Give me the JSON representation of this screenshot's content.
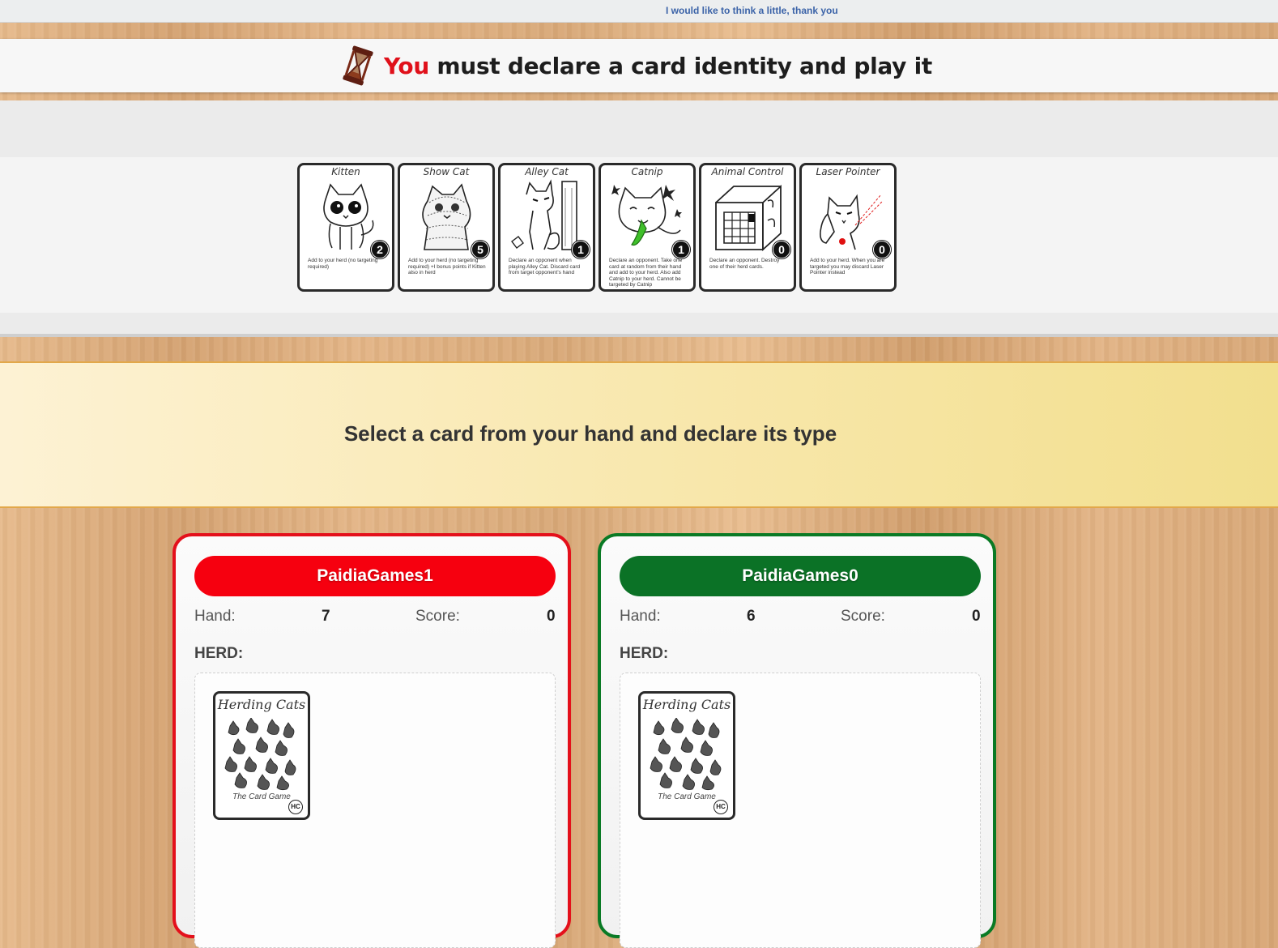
{
  "header": {
    "link_text": "I would like to think a little, thank you",
    "status_you": "You",
    "status_rest": " must declare a card identity and play it"
  },
  "reference_cards": [
    {
      "title": "Kitten",
      "value": "2",
      "text": "Add to your herd (no targeting required)",
      "icon": "kitten-icon"
    },
    {
      "title": "Show Cat",
      "value": "5",
      "text": "Add to your herd (no targeting required) +I bonus points if Kitten also in herd",
      "icon": "show-cat-icon"
    },
    {
      "title": "Alley Cat",
      "value": "1",
      "text": "Declare an opponent when playing Alley Cat. Discard card from target opponent's hand",
      "icon": "alley-cat-icon"
    },
    {
      "title": "Catnip",
      "value": "1",
      "text": "Declare an opponent. Take one card at random from their hand and add to your herd. Also add Catnip to your herd. Cannot be targeted by Catnip",
      "icon": "catnip-icon"
    },
    {
      "title": "Animal Control",
      "value": "0",
      "text": "Declare an opponent. Destroy one of their herd cards.",
      "icon": "animal-control-icon"
    },
    {
      "title": "Laser Pointer",
      "value": "0",
      "text": "Add to your herd. When you are targeted you may discard Laser Pointer instead",
      "icon": "laser-pointer-icon"
    }
  ],
  "prompt": {
    "text": "Select a card from your hand and declare its type"
  },
  "labels": {
    "hand": "Hand:",
    "score": "Score:",
    "herd": "HERD:"
  },
  "players": [
    {
      "name": "PaidiaGames1",
      "hand": "7",
      "score": "0",
      "color": "#f6000f",
      "herd_card": {
        "title": "Herding Cats",
        "subtitle": "The Card Game",
        "badge": "HC"
      }
    },
    {
      "name": "PaidiaGames0",
      "hand": "6",
      "score": "0",
      "color": "#0b7226",
      "herd_card": {
        "title": "Herding Cats",
        "subtitle": "The Card Game",
        "badge": "HC"
      }
    }
  ],
  "colors": {
    "player_red": "#f6000f",
    "player_green": "#0b7226",
    "link": "#3b63a8",
    "you_red": "#e0101a"
  }
}
